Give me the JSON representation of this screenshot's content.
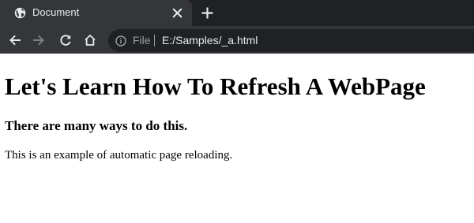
{
  "tab": {
    "title": "Document",
    "favicon": "globe-icon",
    "close_icon": "close-icon",
    "new_tab_icon": "plus-icon"
  },
  "toolbar": {
    "back_icon": "arrow-left-icon",
    "forward_icon": "arrow-right-icon",
    "reload_icon": "reload-icon",
    "home_icon": "home-icon"
  },
  "omnibox": {
    "info_icon": "info-icon",
    "scheme_label": "File",
    "url": "E:/Samples/_a.html"
  },
  "page": {
    "heading": "Let's Learn How To Refresh A WebPage",
    "subheading": "There are many ways to do this.",
    "paragraph": "This is an example of automatic page reloading."
  },
  "colors": {
    "tabstrip_bg": "#202124",
    "toolbar_bg": "#35363a",
    "omnibox_bg": "#202124",
    "text_light": "#e8eaed",
    "text_muted": "#9aa0a6",
    "page_bg": "#ffffff"
  }
}
